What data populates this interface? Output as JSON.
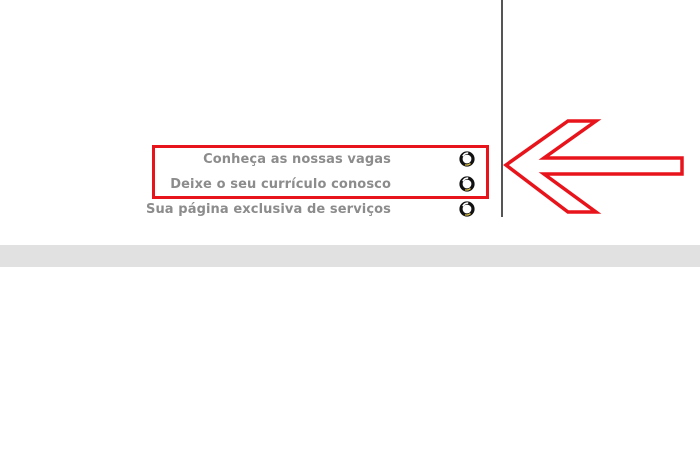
{
  "menu": {
    "items": [
      {
        "label": "Conheça as nossas vagas",
        "icon": "circle-bullet-icon"
      },
      {
        "label": "Deixe o seu currículo conosco",
        "icon": "circle-bullet-icon"
      },
      {
        "label": "Sua página exclusiva de serviços",
        "icon": "circle-bullet-icon"
      }
    ]
  },
  "annotation": {
    "box_color": "#e8141c",
    "arrow_color": "#e8141c",
    "arrow_icon": "arrow-left-icon"
  },
  "colors": {
    "link_text": "#8c8c8c",
    "separator_band": "#e1e1e1",
    "divider": "#555555"
  }
}
